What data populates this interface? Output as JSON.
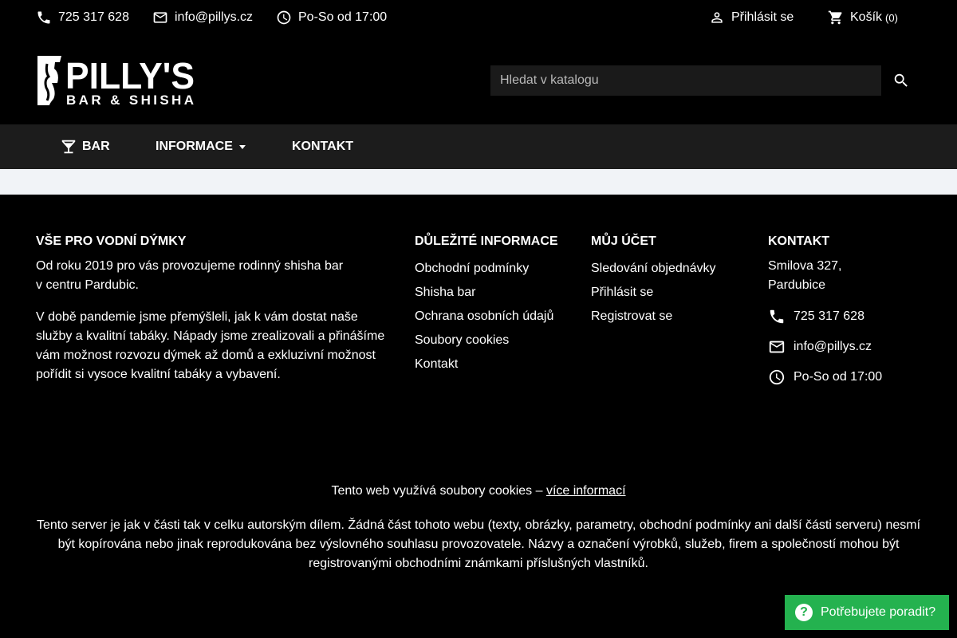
{
  "topbar": {
    "phone": "725 317 628",
    "email": "info@pillys.cz",
    "hours": "Po-So od 17:00",
    "login": "Přihlásit se",
    "cart_label": "Košík",
    "cart_count": "(0)"
  },
  "header": {
    "logo_text_main": "PILLY'S",
    "logo_text_sub": "BAR & SHISHA",
    "search_placeholder": "Hledat v katalogu"
  },
  "nav": {
    "bar": "BAR",
    "info": "INFORMACE",
    "contact": "KONTAKT"
  },
  "footer": {
    "about": {
      "title": "VŠE PRO VODNÍ DÝMKY",
      "p1_line1": "Od roku 2019 pro vás provozujeme rodinný shisha bar",
      "p1_line2": "v centru Pardubic.",
      "p2": "V době pandemie jsme přemýšleli, jak k vám dostat naše služby a kvalitní tabáky. Nápady jsme zrealizovali a přinášíme vám možnost rozvozu dýmek až domů a exkluzivní možnost pořídit si vysoce kvalitní tabáky a vybavení."
    },
    "info": {
      "title": "DŮLEŽITÉ INFORMACE",
      "links": [
        "Obchodní podmínky",
        "Shisha bar",
        "Ochrana osobních údajů",
        "Soubory cookies",
        "Kontakt"
      ]
    },
    "account": {
      "title": "MŮJ ÚČET",
      "links": [
        "Sledování objednávky",
        "Přihlásit se",
        "Registrovat se"
      ]
    },
    "contact": {
      "title": "KONTAKT",
      "address_line1": "Smilova 327,",
      "address_line2": "Pardubice",
      "phone": "725 317 628",
      "email": "info@pillys.cz",
      "hours": "Po-So od 17:00"
    },
    "cookie_text": "Tento web využívá soubory cookies –",
    "cookie_link": "více informací",
    "copyright": "Tento server je jak v části tak v celku autorským dílem. Žádná část tohoto webu (texty, obrázky, parametry, obchodní podmínky ani další části serveru) nesmí být kopírována nebo jinak reprodukována bez výslovného souhlasu provozovatele. Názvy a označení výrobků, služeb, firem a společností mohou být registrovanými obchodními známkami příslušných vlastníků."
  },
  "help": {
    "label": "Potřebujete poradit?"
  }
}
